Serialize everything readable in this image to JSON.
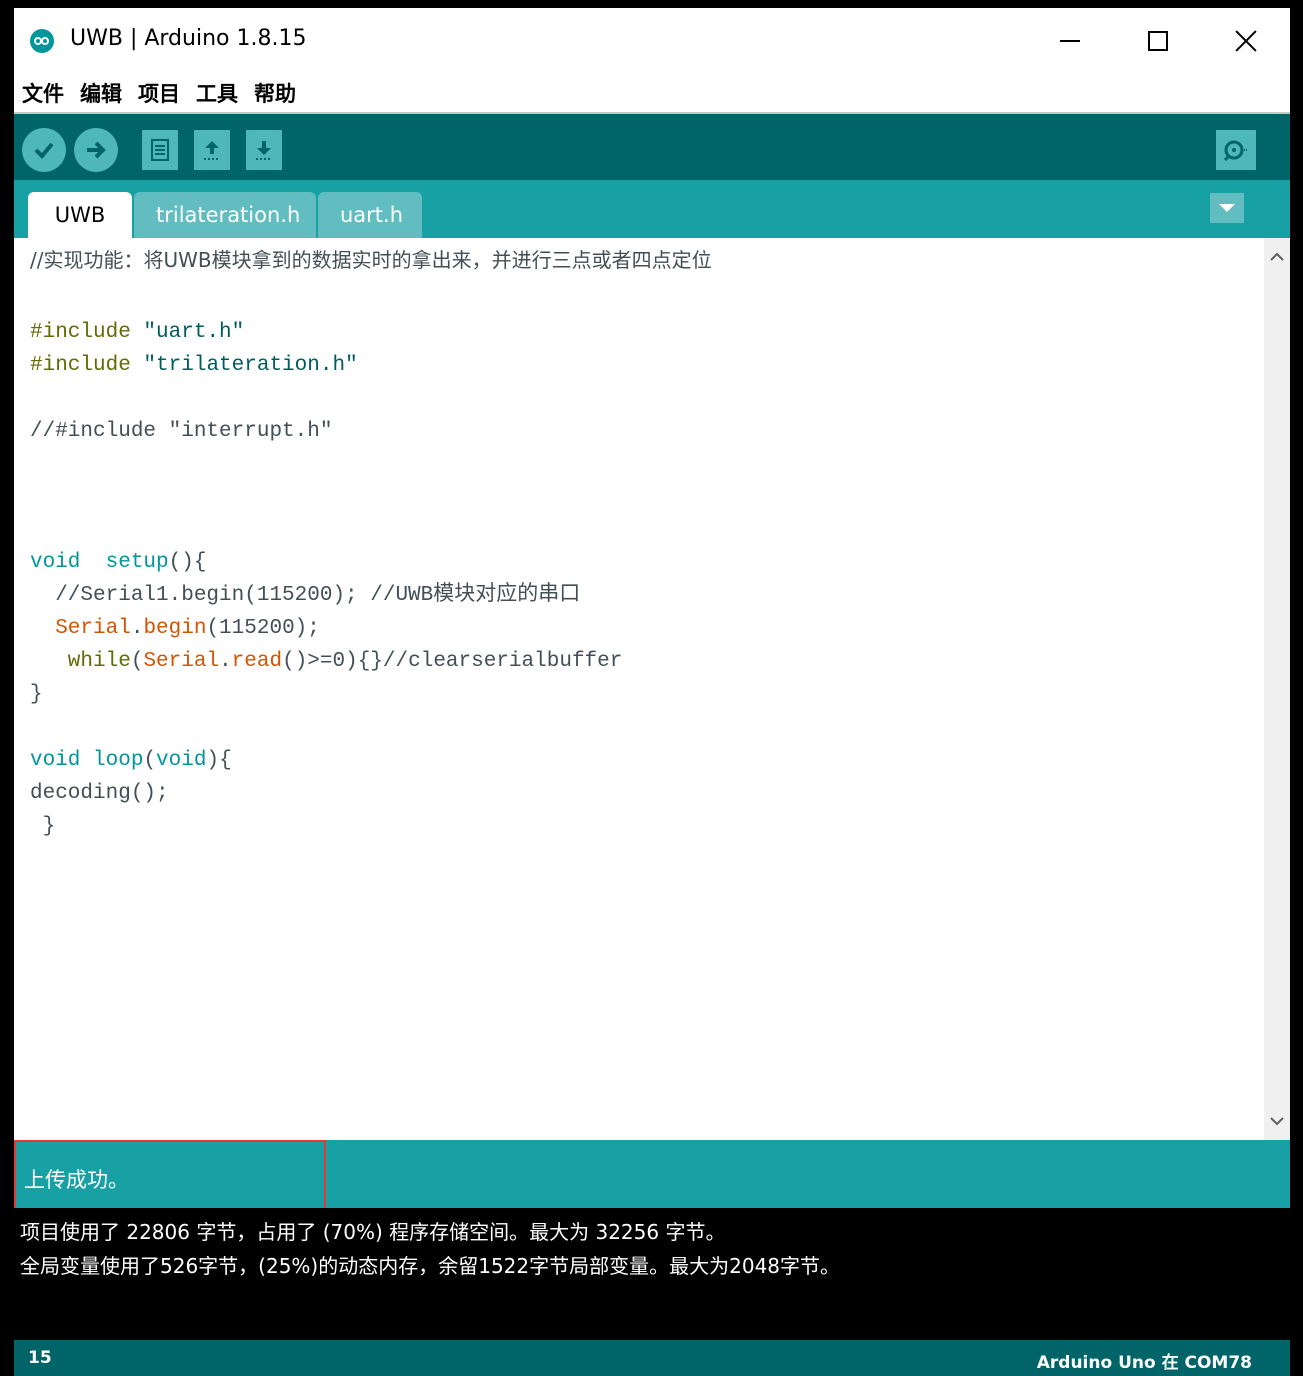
{
  "window": {
    "title": "UWB | Arduino 1.8.15"
  },
  "menu": {
    "items": [
      "文件",
      "编辑",
      "项目",
      "工具",
      "帮助"
    ]
  },
  "toolbar": {
    "icons": [
      "verify-icon",
      "upload-icon",
      "new-icon",
      "open-icon",
      "save-icon",
      "serial-monitor-icon"
    ]
  },
  "tabs": [
    {
      "label": "UWB",
      "active": true
    },
    {
      "label": "trilateration.h",
      "active": false
    },
    {
      "label": "uart.h",
      "active": false
    }
  ],
  "code": {
    "l1": "//实现功能：将UWB模块拿到的数据实时的拿出来，并进行三点或者四点定位",
    "inc1_kw": "#include",
    "inc1_str": " \"uart.h\"",
    "inc2_kw": "#include",
    "inc2_str": " \"trilateration.h\"",
    "l6": "//#include \"interrupt.h\"",
    "setup_kw": "void",
    "setup_fn": "  setup",
    "setup_rest": "(){",
    "l11": "  //Serial1.begin(115200); //UWB模块对应的串口",
    "l12_a": "  Serial",
    "l12_b": ".",
    "l12_c": "begin",
    "l12_d": "(115200);",
    "l13_a": "   while",
    "l13_b": "(",
    "l13_c": "Serial",
    "l13_d": ".",
    "l13_e": "read",
    "l13_f": "()>=0){}//clearserialbuffer",
    "l14": "}",
    "loop_kw": "void",
    "loop_fn": " loop",
    "loop_b": "(",
    "loop_kw2": "void",
    "loop_rest": "){",
    "l17": "decoding();",
    "l18": " }"
  },
  "status": {
    "message": "上传成功。"
  },
  "console": {
    "line1": "项目使用了 22806 字节，占用了 (70%) 程序存储空间。最大为 32256 字节。",
    "line2": "全局变量使用了526字节，(25%)的动态内存，余留1522字节局部变量。最大为2048字节。"
  },
  "bottom": {
    "line_number": "15",
    "board": "Arduino Uno 在 COM78"
  },
  "colors": {
    "toolbar": "#006468",
    "tabbar": "#17a1a5",
    "highlight": "#e53935"
  }
}
